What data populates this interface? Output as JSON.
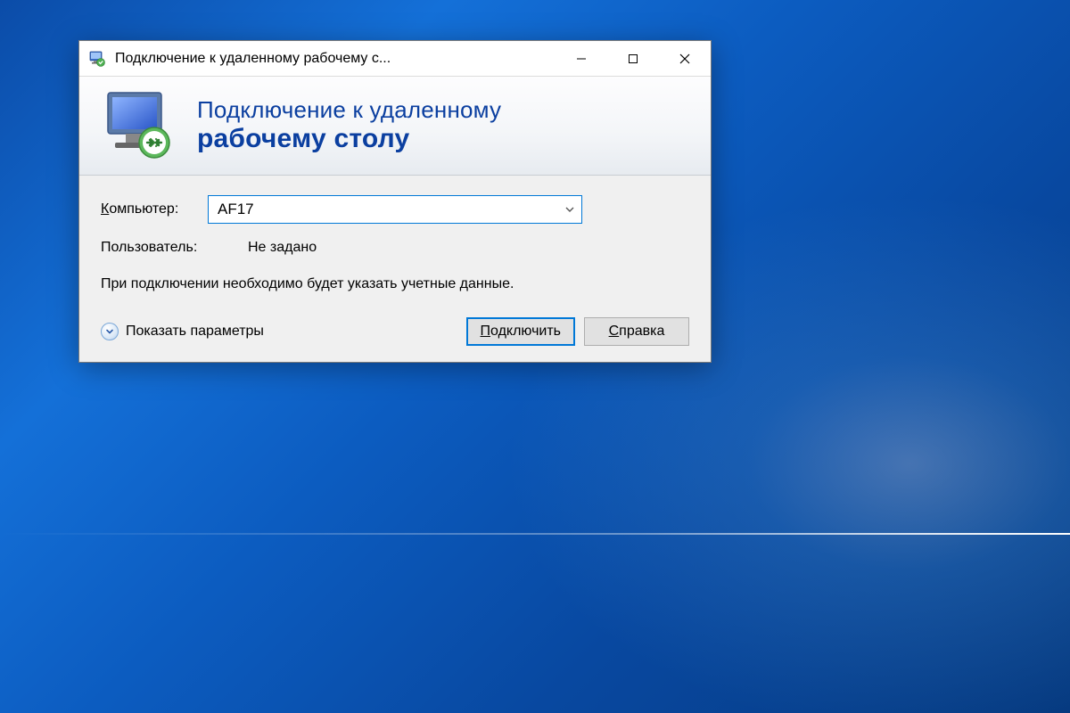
{
  "window": {
    "title": "Подключение к удаленному рабочему с..."
  },
  "banner": {
    "line1": "Подключение к удаленному",
    "line2": "рабочему столу"
  },
  "form": {
    "computer_label_prefix": "К",
    "computer_label_rest": "омпьютер:",
    "computer_value": "AF17",
    "user_label": "Пользователь:",
    "user_value": "Не задано",
    "info_text": "При подключении необходимо будет указать учетные данные."
  },
  "footer": {
    "show_options_label": "Показать параметры",
    "connect_label_prefix": "П",
    "connect_label_rest": "одключить",
    "help_label_prefix": "С",
    "help_label_rest": "правка"
  }
}
